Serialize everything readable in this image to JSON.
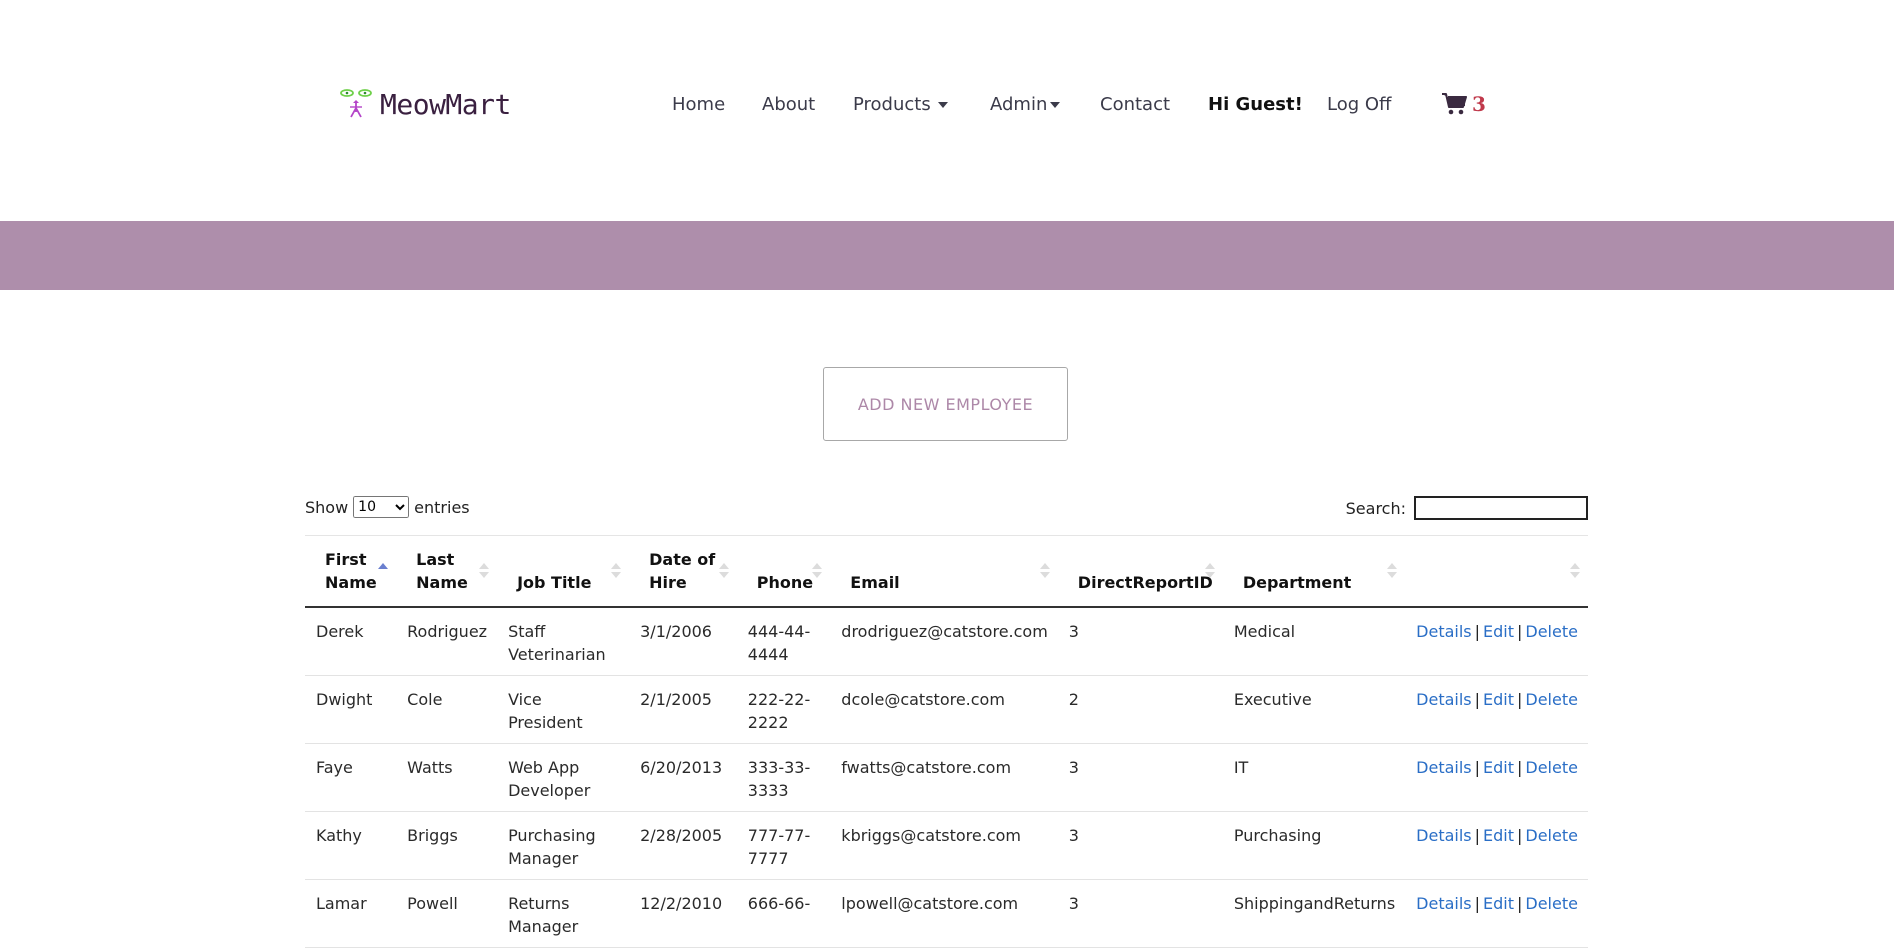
{
  "brand": {
    "name": "MeowMart"
  },
  "nav": {
    "home": "Home",
    "about": "About",
    "products": "Products",
    "admin": "Admin",
    "contact": "Contact",
    "greeting": "Hi Guest!",
    "logoff": "Log Off",
    "cart_count": "3"
  },
  "actions": {
    "add_employee": "ADD NEW EMPLOYEE"
  },
  "controls": {
    "show_label": "Show",
    "entries_label": "entries",
    "page_length": "10",
    "search_label": "Search:",
    "search_value": ""
  },
  "table": {
    "headers": [
      "First Name",
      "Last Name",
      "Job Title",
      "Date of Hire",
      "Phone",
      "Email",
      "DirectReportID",
      "Department",
      ""
    ],
    "rows": [
      {
        "first": "Derek",
        "last": "Rodriguez",
        "title": "Staff Veterinarian",
        "hire": "3/1/2006",
        "phone": "444-44-4444",
        "email": "drodriguez@catstore.com",
        "report": "3",
        "dept": "Medical"
      },
      {
        "first": "Dwight",
        "last": "Cole",
        "title": "Vice President",
        "hire": "2/1/2005",
        "phone": "222-22-2222",
        "email": "dcole@catstore.com",
        "report": "2",
        "dept": "Executive"
      },
      {
        "first": "Faye",
        "last": "Watts",
        "title": "Web App Developer",
        "hire": "6/20/2013",
        "phone": "333-33-3333",
        "email": "fwatts@catstore.com",
        "report": "3",
        "dept": "IT"
      },
      {
        "first": "Kathy",
        "last": "Briggs",
        "title": "Purchasing Manager",
        "hire": "2/28/2005",
        "phone": "777-77-7777",
        "email": "kbriggs@catstore.com",
        "report": "3",
        "dept": "Purchasing"
      },
      {
        "first": "Lamar",
        "last": "Powell",
        "title": "Returns Manager",
        "hire": "12/2/2010",
        "phone": "666-66-",
        "email": "lpowell@catstore.com",
        "report": "3",
        "dept": "ShippingandReturns"
      }
    ],
    "row_actions": {
      "details": "Details",
      "edit": "Edit",
      "delete": "Delete",
      "separator": "|"
    }
  },
  "colors": {
    "band": "#ae8eab",
    "accent_text": "#ad88a8",
    "link": "#2a6ec6",
    "cart_count": "#c0394b"
  },
  "icons": [
    "cat-logo-icon",
    "cart-icon",
    "caret-down-icon",
    "sort-icon"
  ]
}
